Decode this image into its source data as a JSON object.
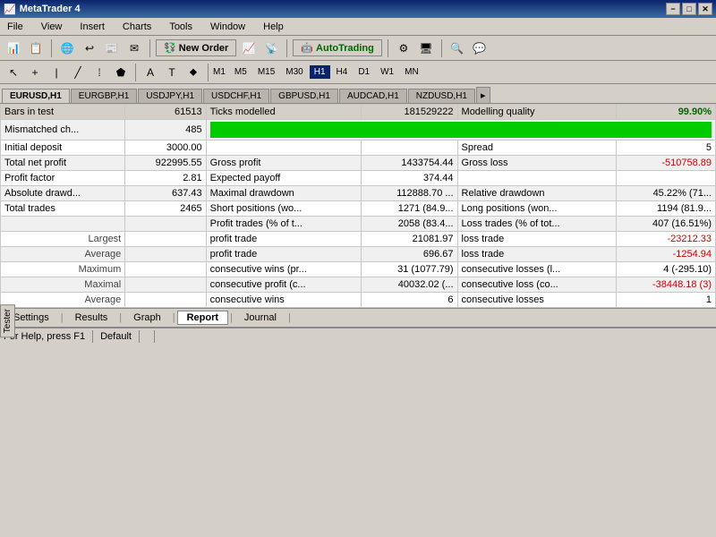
{
  "titlebar": {
    "title": "MetaTrader 4",
    "min": "−",
    "max": "□",
    "close": "✕"
  },
  "menu": {
    "items": [
      "File",
      "View",
      "Insert",
      "Charts",
      "Tools",
      "Window",
      "Help"
    ]
  },
  "toolbar": {
    "new_order": "New Order",
    "autotrading": "AutoTrading"
  },
  "periods": [
    "M1",
    "M5",
    "M15",
    "M30",
    "H1",
    "H4",
    "D1",
    "W1",
    "MN"
  ],
  "active_period": "H1",
  "tabs": [
    "EURUSD,H1",
    "EURGBP,H1",
    "USDJPY,H1",
    "USDCHF,H1",
    "GBPUSD,H1",
    "AUDCAD,H1",
    "NZDUSD,H1"
  ],
  "report": {
    "rows": [
      {
        "col1_label": "Bars in test",
        "col1_val": "61513",
        "col2_label": "Ticks modelled",
        "col2_val": "181529222",
        "col3_label": "Modelling quality",
        "col3_val": "99.90%",
        "green_bar": true
      },
      {
        "col1_label": "Mismatched ch...",
        "col1_val": "485",
        "green_bar_row": true
      },
      {
        "col1_label": "Initial deposit",
        "col1_val": "3000.00",
        "col2_label": "",
        "col2_val": "",
        "col3_label": "Spread",
        "col3_val": "5"
      },
      {
        "col1_label": "Total net profit",
        "col1_val": "922995.55",
        "col2_label": "Gross profit",
        "col2_val": "1433754.44",
        "col3_label": "Gross loss",
        "col3_val": "-510758.89"
      },
      {
        "col1_label": "Profit factor",
        "col1_val": "2.81",
        "col2_label": "Expected payoff",
        "col2_val": "374.44",
        "col3_label": "",
        "col3_val": ""
      },
      {
        "col1_label": "Absolute drawd...",
        "col1_val": "637.43",
        "col2_label": "Maximal drawdown",
        "col2_val": "112888.70 ...",
        "col3_label": "Relative drawdown",
        "col3_val": "45.22% (71..."
      },
      {
        "col1_label": "Total trades",
        "col1_val": "2465",
        "col2_label": "Short positions (wo...",
        "col2_val": "1271 (84.9...",
        "col3_label": "Long positions (won...",
        "col3_val": "1194 (81.9..."
      },
      {
        "col1_label": "",
        "col1_val": "",
        "col2_label": "Profit trades (% of t...",
        "col2_val": "2058 (83.4...",
        "col3_label": "Loss trades (% of tot...",
        "col3_val": "407 (16.51%)"
      },
      {
        "col1_label": "Largest",
        "col1_val": "",
        "col2_label": "profit trade",
        "col2_val": "21081.97",
        "col3_label": "loss trade",
        "col3_val": "-23212.33"
      },
      {
        "col1_label": "Average",
        "col1_val": "",
        "col2_label": "profit trade",
        "col2_val": "696.67",
        "col3_label": "loss trade",
        "col3_val": "-1254.94"
      },
      {
        "col1_label": "Maximum",
        "col1_val": "",
        "col2_label": "consecutive wins (pr...",
        "col2_val": "31 (1077.79)",
        "col3_label": "consecutive losses (l...",
        "col3_val": "4 (-295.10)"
      },
      {
        "col1_label": "Maximal",
        "col1_val": "",
        "col2_label": "consecutive profit (c...",
        "col2_val": "40032.02 (...",
        "col3_label": "consecutive loss (co...",
        "col3_val": "-38448.18 (3)"
      },
      {
        "col1_label": "Average",
        "col1_val": "",
        "col2_label": "consecutive wins",
        "col2_val": "6",
        "col3_label": "consecutive losses",
        "col3_val": "1"
      }
    ]
  },
  "bottom_tabs": [
    "Settings",
    "Results",
    "Graph",
    "Report",
    "Journal"
  ],
  "active_bottom_tab": "Report",
  "status": {
    "help": "For Help, press F1",
    "default": "Default"
  },
  "tester_label": "Tester"
}
